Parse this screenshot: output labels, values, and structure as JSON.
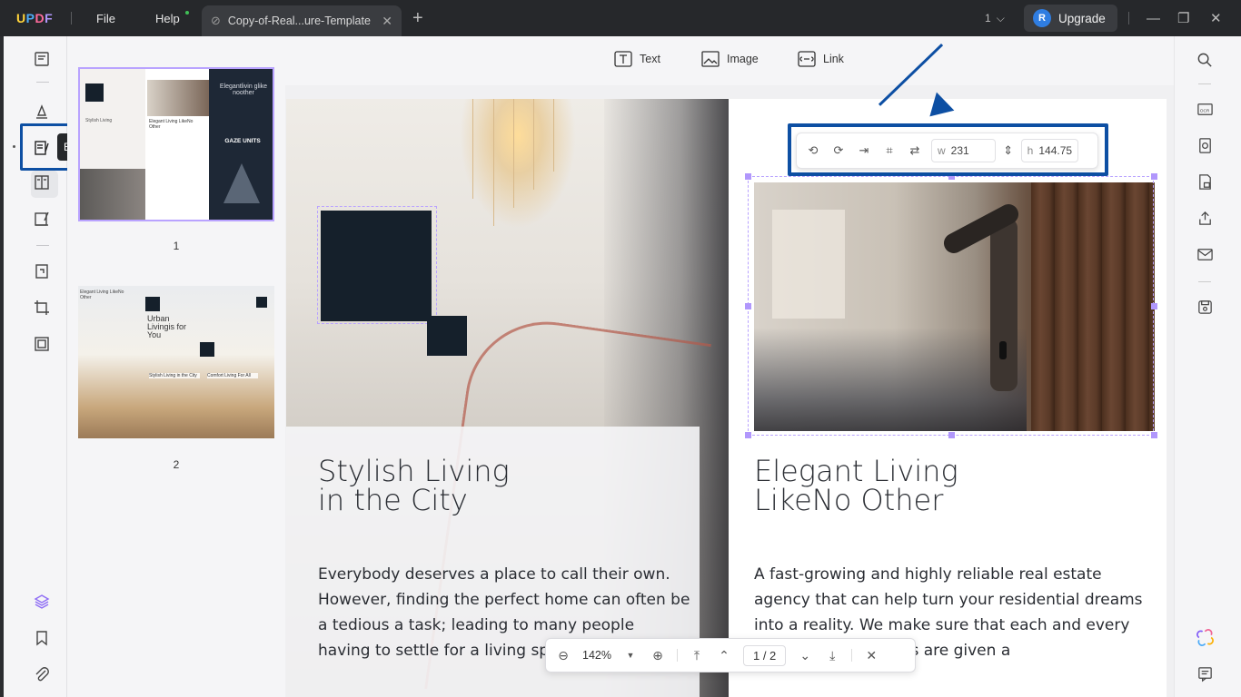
{
  "titlebar": {
    "logo": "UPDF",
    "menu_file": "File",
    "menu_help": "Help",
    "tab_title": "Copy-of-Real...ure-Template",
    "page_indicator": "1",
    "upgrade_avatar": "R",
    "upgrade_label": "Upgrade"
  },
  "left_rail": {
    "tooltip": "Edit PDF"
  },
  "thumbnails": {
    "pages": [
      {
        "label": "1",
        "texts": [
          "Elegantlivin glike noother",
          "GAZE UNITS",
          "Stylish Living",
          "Elegant Living LikeNo Other"
        ]
      },
      {
        "label": "2",
        "texts": [
          "Urban Livingis for You",
          "Elegant Living LikeNo Other",
          "Stylish Living in the City",
          "Comfort Living For All"
        ]
      }
    ]
  },
  "edit_toolbar": {
    "text_label": "Text",
    "image_label": "Image",
    "link_label": "Link"
  },
  "image_toolbar": {
    "width_label": "w",
    "width_value": "231",
    "height_label": "h",
    "height_value": "144.75"
  },
  "page": {
    "left_title_line1": "Stylish Living",
    "left_title_line2": "in the City",
    "left_body": "Everybody deserves a place to call their own.  However, finding the perfect home can often be a tedious a task; leading to many people having to settle for a living space that doesn't",
    "right_title_line1": "Elegant Living",
    "right_title_line2": "LikeNo Other",
    "right_body": "A fast-growing and highly reliable real estate agency that can help turn your residential dreams into a reality. We make sure that each and every one of our customers are given a"
  },
  "page_nav": {
    "zoom": "142%",
    "current_page": "1 / 2"
  },
  "colors": {
    "accent": "#0d4fa3",
    "selection": "#b9a3ff",
    "dark_square": "#15202b",
    "titlebar": "#26282b"
  }
}
